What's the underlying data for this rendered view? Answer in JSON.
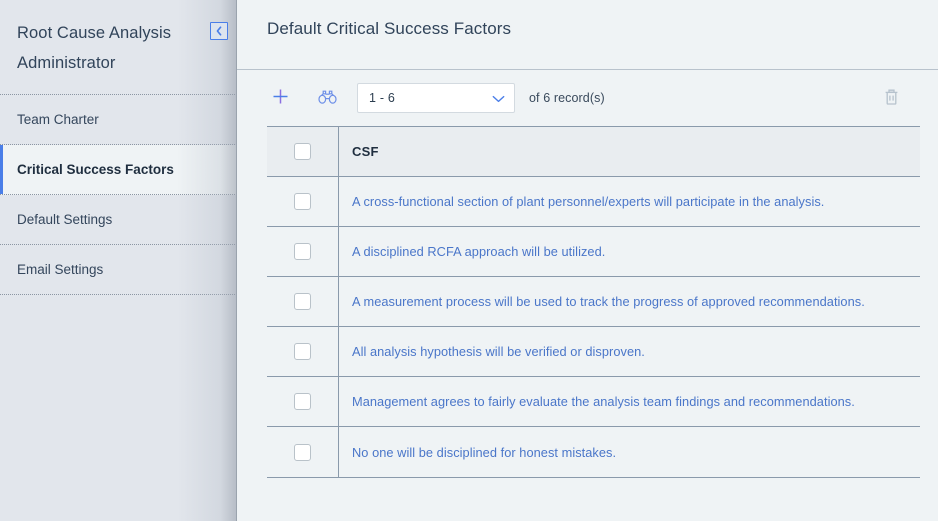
{
  "sidebar": {
    "title": "Root Cause Analysis Administrator",
    "collapse_icon": "chevron-left-icon",
    "items": [
      {
        "label": "Team Charter",
        "active": false
      },
      {
        "label": "Critical Success Factors",
        "active": true
      },
      {
        "label": "Default Settings",
        "active": false
      },
      {
        "label": "Email Settings",
        "active": false
      }
    ]
  },
  "main": {
    "page_title": "Default Critical Success Factors",
    "toolbar": {
      "add_icon": "plus-icon",
      "find_icon": "binoculars-icon",
      "delete_icon": "trash-icon",
      "record_range": "1 - 6",
      "record_count_text": "of 6  record(s)",
      "dropdown_icon": "chevron-down-icon"
    },
    "table": {
      "columns": [
        "CSF"
      ],
      "select_all_checkbox": "unchecked",
      "rows": [
        {
          "csf": "A cross-functional section of plant personnel/experts will participate in the analysis."
        },
        {
          "csf": "A disciplined RCFA approach will be utilized."
        },
        {
          "csf": "A measurement process will be used to track the progress of approved recommendations."
        },
        {
          "csf": "All analysis hypothesis will be verified or disproven."
        },
        {
          "csf": "Management agrees to fairly evaluate the analysis team findings and recommendations."
        },
        {
          "csf": "No one will be disciplined for honest mistakes."
        }
      ]
    }
  },
  "colors": {
    "accent_blue": "#4a7ee8",
    "link_blue": "#4a76c9",
    "sidebar_bg": "#e2e6ec",
    "content_bg": "#eff3f5",
    "border": "#8a9aab",
    "disabled_icon": "#b6c2cd"
  }
}
